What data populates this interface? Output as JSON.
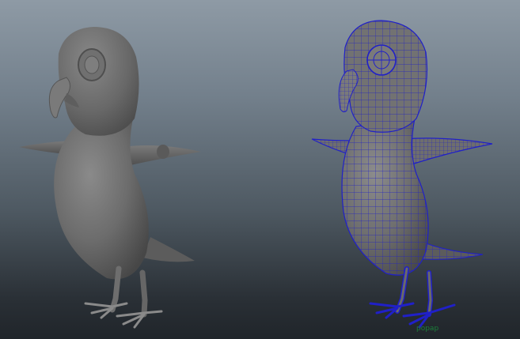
{
  "viewport": {
    "background_top": "#8e9aa5",
    "background_bottom": "#20252a",
    "model_shaded_color": "#6b6b6b",
    "model_wireframe_color": "#2020c8"
  },
  "left_model": {
    "display_mode": "shaded",
    "icon": "parrot-model-shaded"
  },
  "right_model": {
    "display_mode": "shaded-wireframe",
    "icon": "parrot-model-wireframe",
    "selection_label": "popap"
  }
}
